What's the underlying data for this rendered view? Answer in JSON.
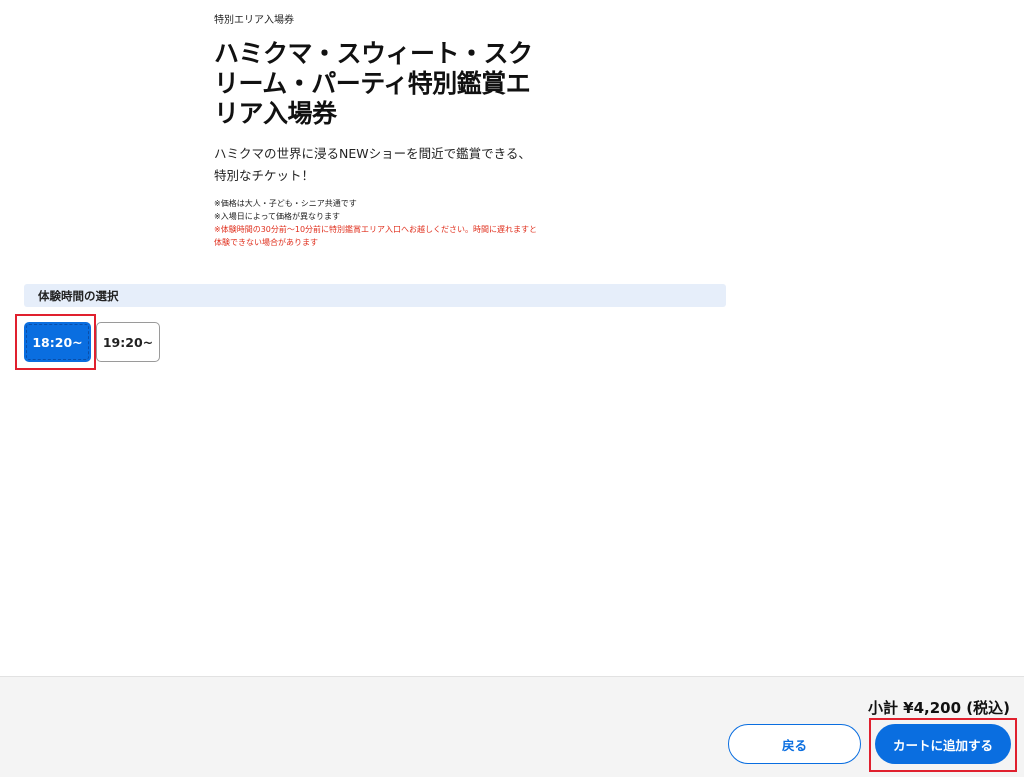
{
  "product": {
    "category": "特別エリア入場券",
    "title": "ハミクマ・スウィート・スクリーム・パーティ特別鑑賞エリア入場券",
    "description": "ハミクマの世界に浸るNEWショーを間近で鑑賞できる、特別なチケット！",
    "notes": [
      "※価格は大人・子ども・シニア共通です",
      "※入場日によって価格が異なります"
    ],
    "warning": "※体験時間の30分前〜10分前に特別鑑賞エリア入口へお越しください。時間に遅れますと体験できない場合があります"
  },
  "time_selection": {
    "heading": "体験時間の選択",
    "slots": [
      {
        "label": "18:20~",
        "selected": true
      },
      {
        "label": "19:20~",
        "selected": false
      }
    ]
  },
  "footer": {
    "subtotal": "小計 ¥4,200 (税込)",
    "back_label": "戻る",
    "add_to_cart_label": "カートに追加する"
  },
  "colors": {
    "primary": "#0a6ee0",
    "section_bg": "#e6eefa",
    "warning": "#e0301e",
    "highlight": "#e0202e",
    "footer_bg": "#f4f4f4"
  }
}
